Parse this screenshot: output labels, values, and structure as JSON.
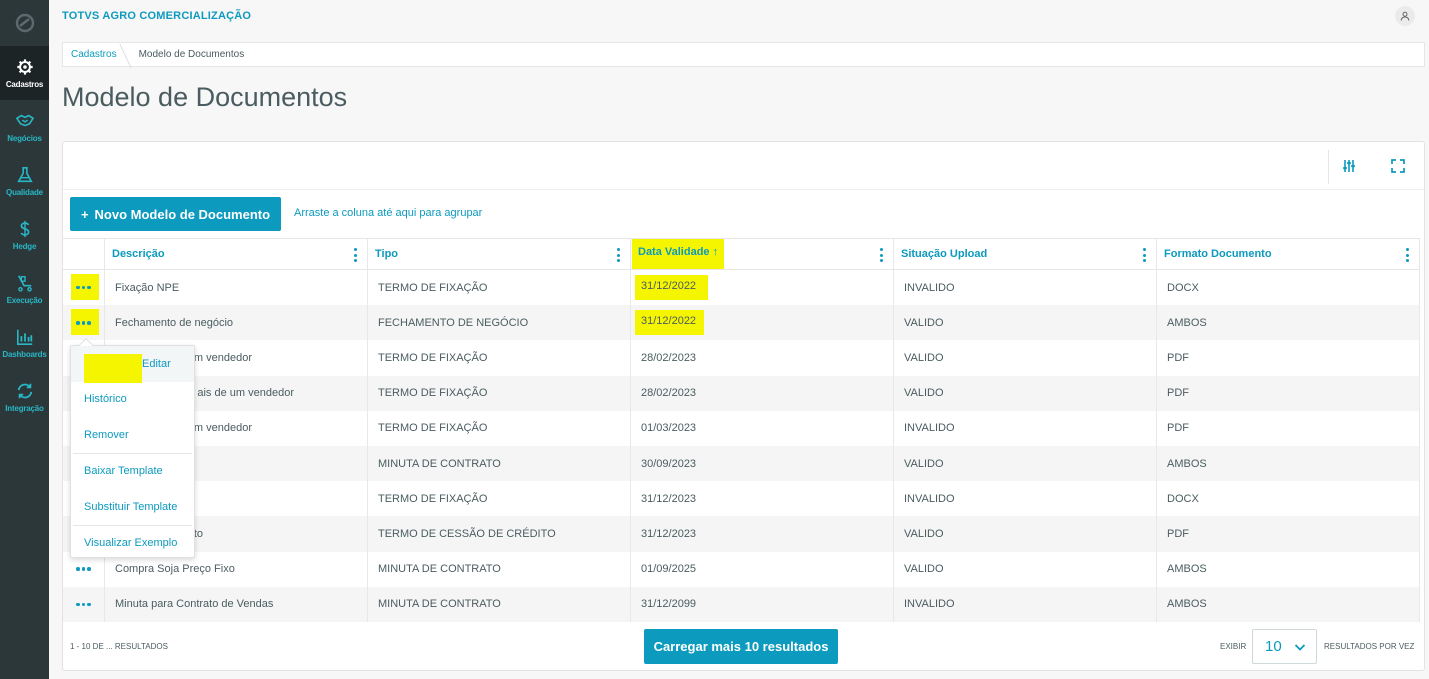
{
  "app": {
    "brand": "TOTVS AGRO COMERCIALIZAÇÃO"
  },
  "sidebar": {
    "items": [
      {
        "label": "Cadastros",
        "icon": "gear-icon",
        "active": true
      },
      {
        "label": "Negócios",
        "icon": "handshake-icon",
        "active": false
      },
      {
        "label": "Qualidade",
        "icon": "flask-icon",
        "active": false
      },
      {
        "label": "Hedge",
        "icon": "dollar-icon",
        "active": false
      },
      {
        "label": "Execução",
        "icon": "conveyor-icon",
        "active": false
      },
      {
        "label": "Dashboards",
        "icon": "bar-chart-icon",
        "active": false
      },
      {
        "label": "Integração",
        "icon": "sync-icon",
        "active": false
      }
    ]
  },
  "breadcrumb": {
    "parent": "Cadastros",
    "current": "Modelo de Documentos"
  },
  "page": {
    "title": "Modelo de Documentos"
  },
  "toolbar": {
    "new_label": "Novo Modelo de Documento",
    "group_hint": "Arraste a coluna até aqui para agrupar"
  },
  "table": {
    "columns": [
      "Descrição",
      "Tipo",
      "Data Validade",
      "Situação Upload",
      "Formato Documento"
    ],
    "sort_indicator": "↑",
    "rows": [
      {
        "descricao": "Fixação NPE",
        "tipo": "TERMO DE FIXAÇÃO",
        "data": "31/12/2022",
        "situacao": "INVALIDO",
        "formato": "DOCX"
      },
      {
        "descricao": "Fechamento de negócio",
        "tipo": "FECHAMENTO DE NEGÓCIO",
        "data": "31/12/2022",
        "situacao": "VALIDO",
        "formato": "AMBOS"
      },
      {
        "descricao": "m vendedor",
        "tipo": "TERMO DE FIXAÇÃO",
        "data": "28/02/2023",
        "situacao": "VALIDO",
        "formato": "PDF"
      },
      {
        "descricao": "ais de um vendedor",
        "tipo": "TERMO DE FIXAÇÃO",
        "data": "28/02/2023",
        "situacao": "VALIDO",
        "formato": "PDF"
      },
      {
        "descricao": "m vendedor",
        "tipo": "TERMO DE FIXAÇÃO",
        "data": "01/03/2023",
        "situacao": "INVALIDO",
        "formato": "PDF"
      },
      {
        "descricao": "",
        "tipo": "MINUTA DE CONTRATO",
        "data": "30/09/2023",
        "situacao": "VALIDO",
        "formato": "AMBOS"
      },
      {
        "descricao": "",
        "tipo": "TERMO DE FIXAÇÃO",
        "data": "31/12/2023",
        "situacao": "INVALIDO",
        "formato": "DOCX"
      },
      {
        "descricao": "to",
        "tipo": "TERMO DE CESSÃO DE CRÉDITO",
        "data": "31/12/2023",
        "situacao": "VALIDO",
        "formato": "PDF"
      },
      {
        "descricao": "Compra Soja Preço Fixo",
        "tipo": "MINUTA DE CONTRATO",
        "data": "01/09/2025",
        "situacao": "VALIDO",
        "formato": "AMBOS"
      },
      {
        "descricao": "Minuta para Contrato de Vendas",
        "tipo": "MINUTA DE CONTRATO",
        "data": "31/12/2099",
        "situacao": "INVALIDO",
        "formato": "AMBOS"
      }
    ]
  },
  "row_menu": {
    "items": [
      "Editar",
      "Histórico",
      "Remover",
      "Baixar Template",
      "Substituir Template",
      "Visualizar Exemplo"
    ]
  },
  "footer": {
    "results_info": "1 - 10 DE ... RESULTADOS",
    "load_more": "Carregar mais 10 resultados",
    "exibir": "EXIBIR",
    "page_size": "10",
    "per_vez": "RESULTADOS POR VEZ"
  },
  "colors": {
    "accent": "#0c9abe",
    "sidebar": "#2c3739",
    "highlight": "#f5f500"
  }
}
